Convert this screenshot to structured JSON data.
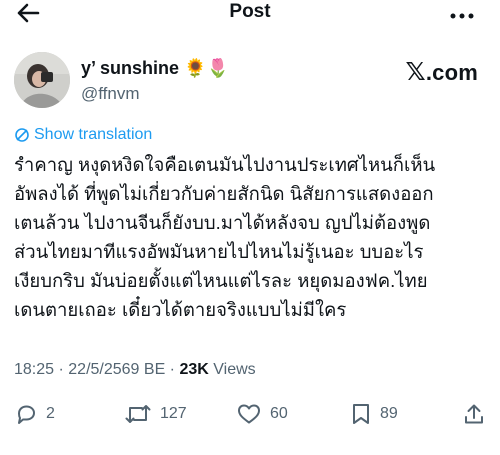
{
  "header": {
    "title": "Post"
  },
  "author": {
    "display_name": "y’ sunshine 🌻🌷",
    "handle": "@ffnvm"
  },
  "source_logo": {
    "text": ".com"
  },
  "translate_label": "Show translation",
  "post_text": "รำคาญ หงุดหงิดใจคือเตนมันไปงานประเทศไหนก็เห็น\nอัพลงได้ ที่พูดไม่เกี่ยวกับค่ายสักนิด นิสัยการแสดงออก\nเตนล้วน ไปงานจีนก็ยังบบ.มาได้หลังจบ ญปไม่ต้องพูด\nส่วนไทยมาทีแรงอัพมันหายไปไหนไม่รู้เนอะ บบอะไร\nเงียบกริบ มันบ่อยตั้งแต่ไหนแต่ไรละ หยุดมองฟค.ไทย\nเดนตายเถอะ เดี๋ยวได้ตายจริงแบบไม่มีใคร",
  "meta": {
    "time": "18:25",
    "date": "22/5/2569 BE",
    "views_count": "23K",
    "views_label": "Views"
  },
  "actions": {
    "replies": "2",
    "reposts": "127",
    "likes": "60",
    "bookmarks": "89"
  },
  "colors": {
    "accent": "#1d9bf0",
    "muted": "#536471",
    "text": "#0f1419"
  },
  "icons": [
    "back-arrow-icon",
    "more-icon",
    "translate-icon",
    "reply-icon",
    "repost-icon",
    "like-icon",
    "bookmark-icon",
    "share-icon"
  ]
}
